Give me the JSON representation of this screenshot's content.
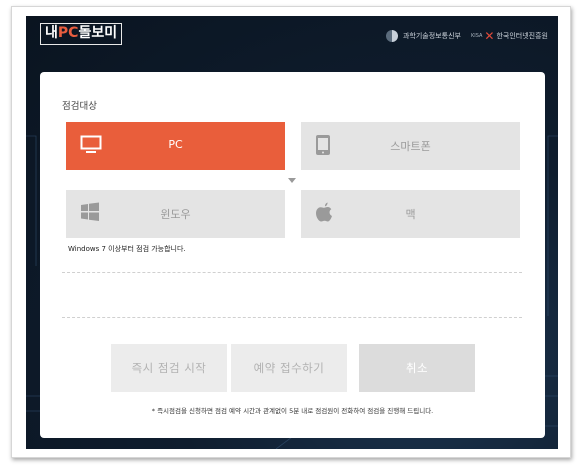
{
  "header": {
    "logo_left": "내",
    "logo_highlight": "PC",
    "logo_right": "돌보미",
    "ministry": "과학기술정보통신부",
    "kisa_small": "KISA",
    "kisa_name": "한국인터넷진흥원"
  },
  "panel": {
    "section_title": "점검대상",
    "device_options": [
      {
        "label": "PC",
        "icon": "monitor-icon",
        "selected": true
      },
      {
        "label": "스마트폰",
        "icon": "smartphone-icon",
        "selected": false
      }
    ],
    "os_options": [
      {
        "label": "윈도우",
        "icon": "windows-icon"
      },
      {
        "label": "맥",
        "icon": "apple-icon"
      }
    ],
    "os_note": "Windows 7 이상부터 점검 가능합니다.",
    "buttons": {
      "immediate": "즉시 점검 시작",
      "reserve": "예약 접수하기",
      "cancel": "취소"
    },
    "footer_note": "* 즉시점검을 신청하면 점검 예약 시간과 관계없이 5분 내로 점검원이 전화하여 점검을 진행해 드립니다."
  },
  "colors": {
    "accent": "#e95e3b",
    "option_bg": "#e4e4e4",
    "background_dark": "#0f1d2e"
  }
}
